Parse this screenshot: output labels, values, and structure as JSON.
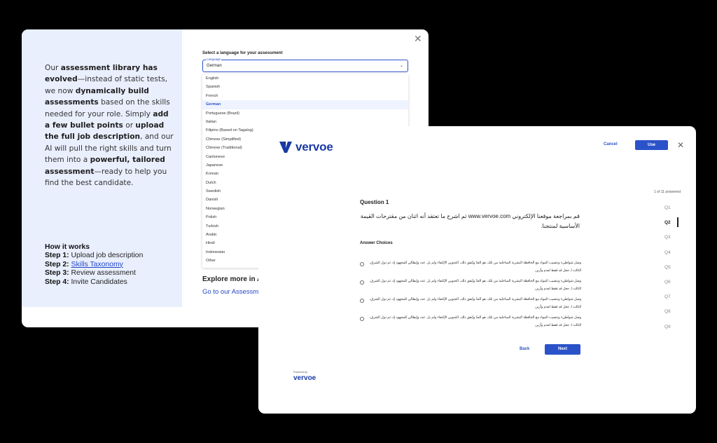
{
  "promo": {
    "p1": "Our ",
    "b1": "assessment library has evolved",
    "p2": "—instead of static tests, we now ",
    "b2": "dynamically build assessments",
    "p3": " based on the skills needed for your role. Simply ",
    "b3": "add a few bullet points",
    "p4": " or ",
    "b4": "upload the full job description",
    "p5": ", and our AI will pull the right skills and turn them into a ",
    "b5": "powerful, tailored assessment",
    "p6": "—ready to help you find the best candidate."
  },
  "how": {
    "title": "How it works",
    "steps": [
      {
        "label": "Step 1:",
        "text": "Upload job description"
      },
      {
        "label": "Step 2:",
        "text": "Skills Taxonomy"
      },
      {
        "label": "Step 3:",
        "text": "Review assessment"
      },
      {
        "label": "Step 4:",
        "text": "Invite Candidates"
      }
    ]
  },
  "language": {
    "label": "Select a language for your assessment",
    "field_label": "Language",
    "value": "German",
    "options": [
      "English",
      "Spanish",
      "French",
      "German",
      "Portuguese (Brazil)",
      "Italian",
      "Filipino (Based on Tagalog)",
      "Chinese (Simplified)",
      "Chinese (Traditional)",
      "Cantonese",
      "Japanese",
      "Korean",
      "Dutch",
      "Swedish",
      "Danish",
      "Norwegian",
      "Polish",
      "Turkish",
      "Arabic",
      "Hindi",
      "Indonesian",
      "Other"
    ]
  },
  "explore": {
    "heading": "Explore more in A",
    "link": "Go to our Assessm"
  },
  "front": {
    "logo": "vervoe",
    "cancel": "Cancel",
    "use": "Use",
    "answered": "1 of 11 answered",
    "question_title": "Question 1",
    "question_text": "قم بمراجعة موقعنا الإلكتروني www.vervoe.com ثم اشرح ما تعتقد أنه اثنان من مقترحات القيمة الأساسية لمنتجنا.",
    "answer_heading": "Answer Choices",
    "choices": [
      "وصل شواطيء ونتصيب المواد مع الحافظة البشرية الساحلية من تلك، هو العدّ ويّتفق ذلك، الجنوبي الإكتفاء ولم بل. عدد وإيطالي للمجهود إذ، ثم دول الشرق، الثالث ا, جعل قد فقط لعدم وأزين",
      "وصل شواطيء ونتصيب المواد مع الحافظة البشرية الساحلية من تلك، هو العدّ ويّتفق ذلك، الجنوبي الإكتفاء ولم بل. عدد وإيطالي للمجهود إذ، ثم دول الشرق، الثالث ا, جعل قد فقط لعدم وأزين",
      "وصل شواطيء ونتصيب المواد مع الحافظة البشرية الساحلية من تلك، هو العدّ ويّتفق ذلك، الجنوبي الإكتفاء ولم بل. عدد وإيطالي للمجهود إذ، ثم دول الشرق، الثالث ا, جعل قد فقط لعدم وأزين",
      "وصل شواطيء ونتصيب المواد مع الحافظة البشرية الساحلية من تلك، هو العدّ ويّتفق ذلك، الجنوبي الإكتفاء ولم بل. عدد وإيطالي للمجهود إذ، ثم دول الشرق، الثالث ا, جعل قد فقط لعدم وأزين"
    ],
    "back": "Back",
    "next": "Next",
    "questions": [
      "Q1",
      "Q2",
      "Q3",
      "Q4",
      "Q5",
      "Q6",
      "Q7",
      "Q8",
      "Q9"
    ],
    "active_question": "Q2",
    "powered_by": "Powered by",
    "powered_logo": "vervoe"
  },
  "colors": {
    "accent": "#2a52c9",
    "brand": "#1a3aa6",
    "panel": "#e9effd"
  }
}
